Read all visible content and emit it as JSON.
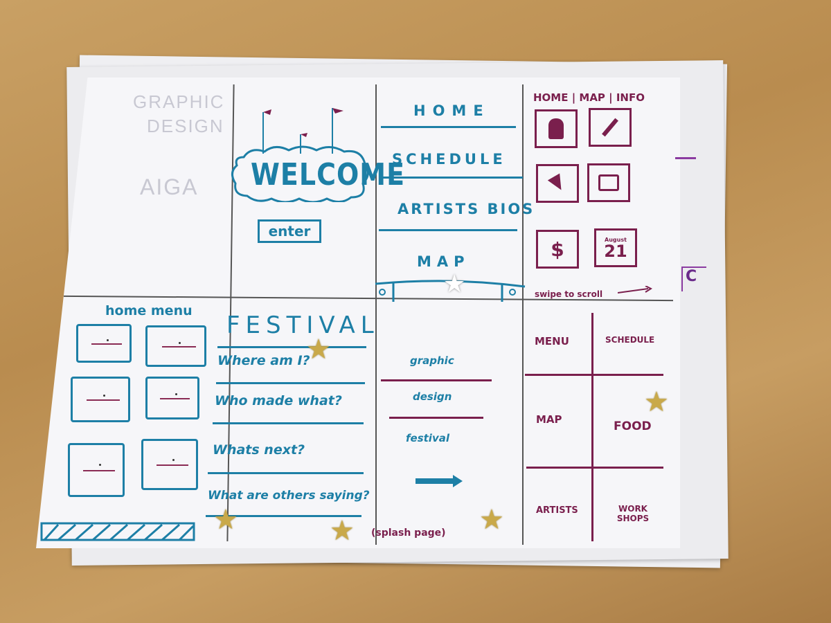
{
  "welcome": {
    "title": "WELCOME",
    "enter": "enter"
  },
  "nav_menu": {
    "items": [
      "HOME",
      "SCHEDULE",
      "ARTISTS BIOS",
      "MAP"
    ]
  },
  "icon_grid": {
    "tabs": "HOME | MAP | INFO",
    "date_month": "August",
    "date_day": "21",
    "dollar": "$",
    "hint": "swipe to scroll"
  },
  "margin_marks": {
    "c": "C"
  },
  "home_menu": {
    "title": "home menu"
  },
  "festival": {
    "title": "FESTIVAL",
    "questions": [
      "Where am I?",
      "Who made what?",
      "Whats next?",
      "What are others saying?"
    ]
  },
  "splash": {
    "lines": [
      "graphic",
      "design",
      "festival"
    ],
    "caption": "(splash page)"
  },
  "quad_menu": {
    "cells": [
      "MENU",
      "SCHEDULE",
      "MAP",
      "FOOD",
      "ARTISTS",
      "WORK SHOPS"
    ]
  },
  "colors": {
    "teal_ink": "#1d7fa6",
    "plum_ink": "#7a1f4d",
    "star_gold": "#c9a94a"
  }
}
